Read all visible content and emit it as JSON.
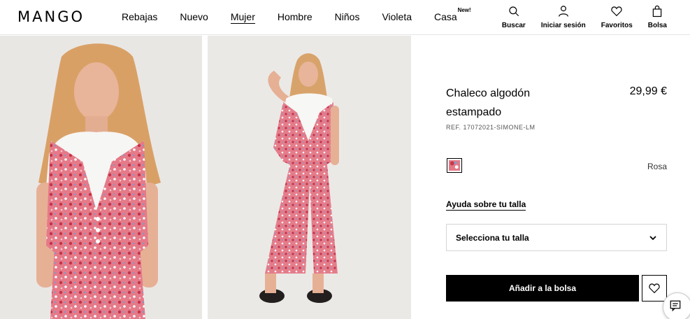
{
  "brand": {
    "logo": "MANGO"
  },
  "nav": {
    "items": [
      {
        "label": "Rebajas"
      },
      {
        "label": "Nuevo"
      },
      {
        "label": "Mujer"
      },
      {
        "label": "Hombre"
      },
      {
        "label": "Niños"
      },
      {
        "label": "Violeta"
      },
      {
        "label": "Casa",
        "badge": "New!"
      }
    ]
  },
  "header_actions": {
    "search": "Buscar",
    "login": "Iniciar sesión",
    "favorites": "Favoritos",
    "bag": "Bolsa"
  },
  "product": {
    "title_line1": "Chaleco algodón",
    "title_line2": "estampado",
    "price": "29,99 €",
    "ref": "REF. 17072021-SIMONE-LM",
    "color_name": "Rosa",
    "size_help": "Ayuda sobre tu talla",
    "size_select_placeholder": "Selecciona tu talla",
    "add_to_bag": "Añadir a la bolsa"
  },
  "colors": {
    "print_pink": "#e37987",
    "print_red": "#c9384b",
    "accent_black": "#000000",
    "background_image": "#e9e7e4"
  },
  "icons": {
    "search": "search-icon",
    "login": "user-icon",
    "favorites": "heart-icon",
    "bag": "shopping-bag-icon",
    "dropdown": "chevron-down-icon",
    "chat": "chat-icon"
  }
}
